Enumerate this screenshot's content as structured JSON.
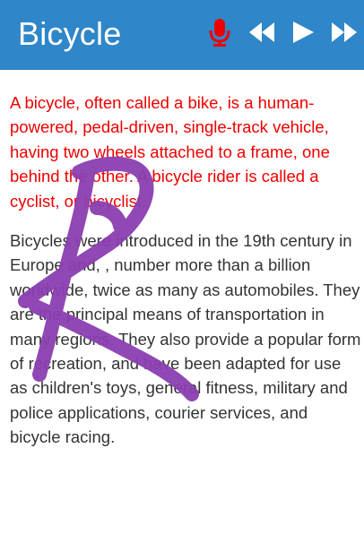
{
  "header": {
    "title": "Bicycle",
    "background_color": "#2f86c8",
    "icons": {
      "mic": "microphone-icon",
      "prev": "rewind-icon",
      "play": "play-icon",
      "next": "fast-forward-icon"
    },
    "mic_color": "#ee0000"
  },
  "article": {
    "intro": "A bicycle, often called a bike, is a human-powered, pedal-driven, single-track vehicle, having two wheels attached to a frame, one behind the other. A bicycle rider is called a cyclist, or bicyclist.",
    "body": "Bicycles were introduced in the 19th century in Europe and, , number more than a billion worldwide, twice as many as automobiles. They are the principal means of transportation in many regions. They also provide a popular form of recreation, and have been adapted for use as children's toys, general fitness, military and police applications, courier services, and bicycle racing.",
    "intro_color": "#ee0000",
    "body_color": "#333333"
  },
  "annotation": {
    "type": "handwritten-scribble",
    "color": "#8a3fb0"
  }
}
